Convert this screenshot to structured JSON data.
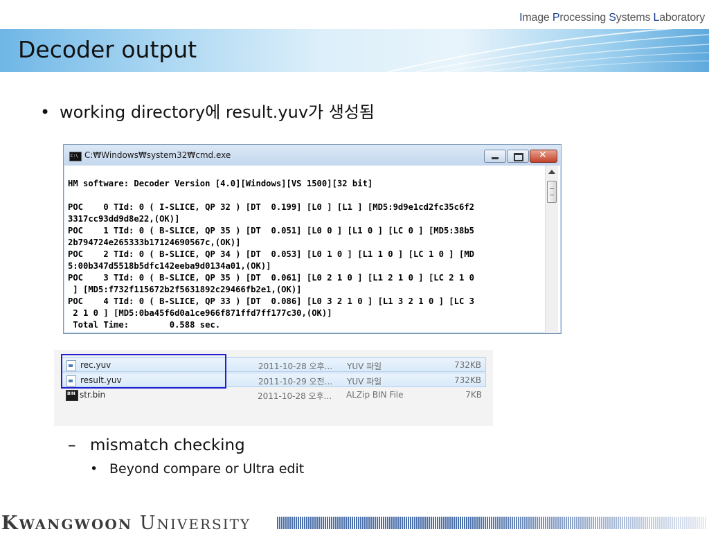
{
  "header": {
    "lab_parts": [
      {
        "cap": "I",
        "rest": "mage "
      },
      {
        "cap": "P",
        "rest": "rocessing "
      },
      {
        "cap": "S",
        "rest": "ystems "
      },
      {
        "cap": "L",
        "rest": "aboratory"
      }
    ]
  },
  "slide": {
    "title": "Decoder output",
    "bullet": "working directory에 result.yuv가 생성됨",
    "dash_item": "mismatch checking",
    "sub_item": "Beyond compare or Ultra edit"
  },
  "cmd": {
    "window_title": "C:₩Windows₩system32₩cmd.exe",
    "icon_label": "C:\\",
    "lines": [
      "HM software: Decoder Version [4.0][Windows][VS 1500][32 bit]",
      "",
      "POC    0 TId: 0 ( I-SLICE, QP 32 ) [DT  0.199] [L0 ] [L1 ] [MD5:9d9e1cd2fc35c6f2",
      "3317cc93dd9d8e22,(OK)]",
      "POC    1 TId: 0 ( B-SLICE, QP 35 ) [DT  0.051] [L0 0 ] [L1 0 ] [LC 0 ] [MD5:38b5",
      "2b794724e265333b17124690567c,(OK)]",
      "POC    2 TId: 0 ( B-SLICE, QP 34 ) [DT  0.053] [L0 1 0 ] [L1 1 0 ] [LC 1 0 ] [MD",
      "5:00b347d5518b5dfc142eeba9d0134a01,(OK)]",
      "POC    3 TId: 0 ( B-SLICE, QP 35 ) [DT  0.061] [L0 2 1 0 ] [L1 2 1 0 ] [LC 2 1 0",
      " ] [MD5:f732f115672b2f5631892c29466fb2e1,(OK)]",
      "POC    4 TId: 0 ( B-SLICE, QP 33 ) [DT  0.086] [L0 3 2 1 0 ] [L1 3 2 1 0 ] [LC 3",
      " 2 1 0 ] [MD5:0ba45f6d0a1ce966f871ffd7ff177c30,(OK)]",
      " Total Time:        0.588 sec."
    ]
  },
  "files": [
    {
      "name": "rec.yuv",
      "date": "2011-10-28 오후...",
      "type": "YUV 파일",
      "size": "732KB",
      "selected": true,
      "icon": "yuv-file-icon"
    },
    {
      "name": "result.yuv",
      "date": "2011-10-29 오전...",
      "type": "YUV 파일",
      "size": "732KB",
      "selected": true,
      "icon": "yuv-file-icon"
    },
    {
      "name": "str.bin",
      "date": "2011-10-28 오후...",
      "type": "ALZip BIN File",
      "size": "7KB",
      "selected": false,
      "icon": "bin-file-icon",
      "icon_label": "BIN"
    }
  ],
  "footer": {
    "univ_k": "K",
    "univ_wangwoon": "WANGWOON",
    "univ_u": "U",
    "univ_niversity": "NIVERSITY"
  },
  "colors": {
    "lab_accent": "#1c3f8f",
    "highlight_box": "#1f1fd0",
    "barcode": "#4b6fa8"
  }
}
